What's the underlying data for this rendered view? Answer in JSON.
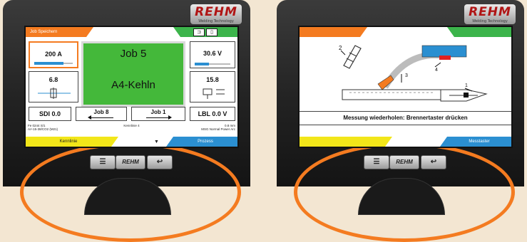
{
  "left": {
    "brand": "REHM",
    "brand_sub": "Welding Technology",
    "softkeys": {
      "top_left": "Job Speichern",
      "bottom_left": "Kennlinie",
      "bottom_right": "Prozess"
    },
    "mode_icons": [
      "⊐",
      "▯"
    ],
    "tiles": {
      "current": {
        "value": "200 A",
        "bar_fraction": 0.75
      },
      "voltage": {
        "value": "30.6 V"
      },
      "param_left": {
        "value": "6.8"
      },
      "param_right": {
        "value": "15.8"
      },
      "sdi": "SDI 0.0",
      "lbl": "LBL 0.0 V"
    },
    "job": {
      "title": "Job 5",
      "name": "A4-Kehln"
    },
    "job_prev": "Job 8",
    "job_next": "Job 1",
    "status": {
      "left_line1": "Fe 0244 S/1",
      "left_line2": "Ar+15-38/CO2 (M21)",
      "center": "Kennlinie 4",
      "right_line1": "0.8 mm",
      "right_line2": "MSG Normal Power Arc"
    },
    "dropdown_icon": "▼",
    "hw_buttons": [
      "☰",
      "REHM",
      "↩"
    ]
  },
  "right": {
    "brand": "REHM",
    "brand_sub": "Welding Technology",
    "softkeys": {
      "bottom_right": "Messtaster"
    },
    "callouts": [
      "2",
      "3",
      "4",
      "1"
    ],
    "message": "Messung wiederholen: Brennertaster drücken",
    "dropdown_icon": "▼",
    "hw_buttons": [
      "☰",
      "REHM",
      "↩"
    ]
  },
  "colors": {
    "orange": "#f47b20",
    "green": "#3cb44b",
    "yellow": "#f2e619",
    "blue": "#2b8fd1",
    "job_green": "#44b83a"
  }
}
